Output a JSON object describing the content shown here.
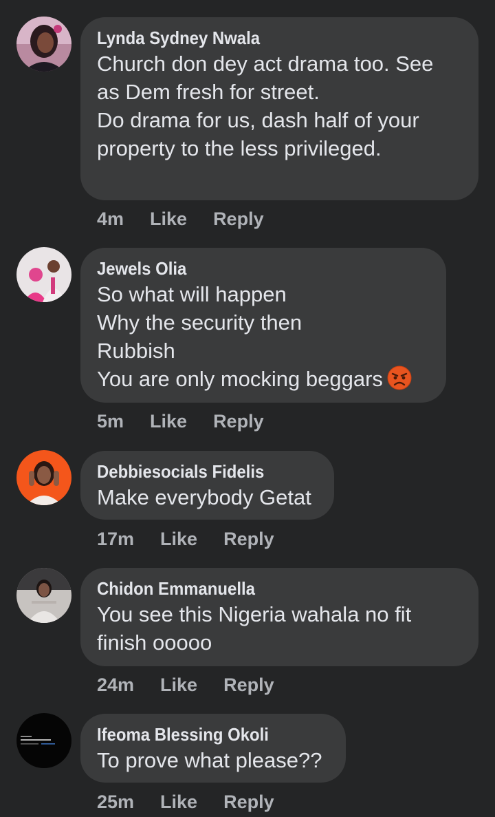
{
  "comments": [
    {
      "author": "Lynda Sydney Nwala",
      "text": "Church don dey act drama too. See\nas Dem fresh for street.\n Do drama for us, dash half of your\nproperty to the less privileged.",
      "time": "4m",
      "like": "Like",
      "reply": "Reply",
      "avatar_icon": "profile-photo-woman-dark-hair"
    },
    {
      "author": "Jewels Olia",
      "text": "So what will happen\nWhy the security then\nRubbish\nYou are only mocking beggars",
      "emoji": "angry-face",
      "time": "5m",
      "like": "Like",
      "reply": "Reply",
      "avatar_icon": "profile-photo-couple-pink"
    },
    {
      "author": "Debbiesocials Fidelis",
      "text": "Make everybody Getat",
      "time": "17m",
      "like": "Like",
      "reply": "Reply",
      "avatar_icon": "profile-photo-woman-orange-bg"
    },
    {
      "author": "Chidon Emmanuella",
      "text": "You see this Nigeria wahala no fit\nfinish ooooo",
      "time": "24m",
      "like": "Like",
      "reply": "Reply",
      "avatar_icon": "profile-photo-woman-selfie"
    },
    {
      "author": "Ifeoma Blessing Okoli",
      "text": "To prove what please??",
      "time": "25m",
      "like": "Like",
      "reply": "Reply",
      "avatar_icon": "profile-photo-screenshot-dark"
    }
  ],
  "colors": {
    "background": "#242526",
    "bubble": "#3a3b3c",
    "text": "#e4e6eb",
    "secondary": "#b0b3b8"
  }
}
